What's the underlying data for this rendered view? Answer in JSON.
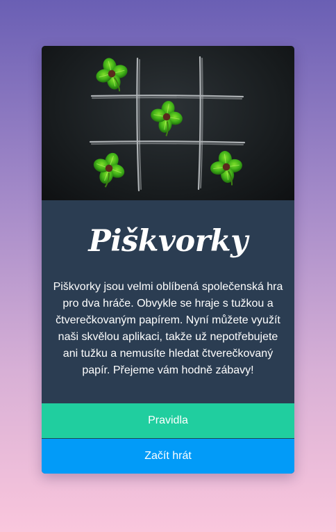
{
  "card": {
    "image": {
      "subject": "tic-tac-toe grid drawn in chalk with four-leaf clovers",
      "icon": "clover-icon"
    },
    "title": "Piškvorky",
    "description": "Piškvorky jsou velmi oblíbená společenská hra pro dva hráče. Obvykle se hraje s tužkou a čtverečkovaným papírem. Nyní můžete využít naši skvělou aplikaci, takže už nepotřebujete ani tužku a nemusíte hledat čtverečkovaný papír. Přejeme vám hodně zábavy!"
  },
  "buttons": {
    "rules_label": "Pravidla",
    "play_label": "Začít hrát"
  },
  "colors": {
    "background_top": "#6a5fb4",
    "background_bottom": "#fac6dc",
    "panel": "#2b3d52",
    "rules_button": "#20ce9f",
    "play_button": "#029bf8",
    "text": "#ffffff"
  }
}
